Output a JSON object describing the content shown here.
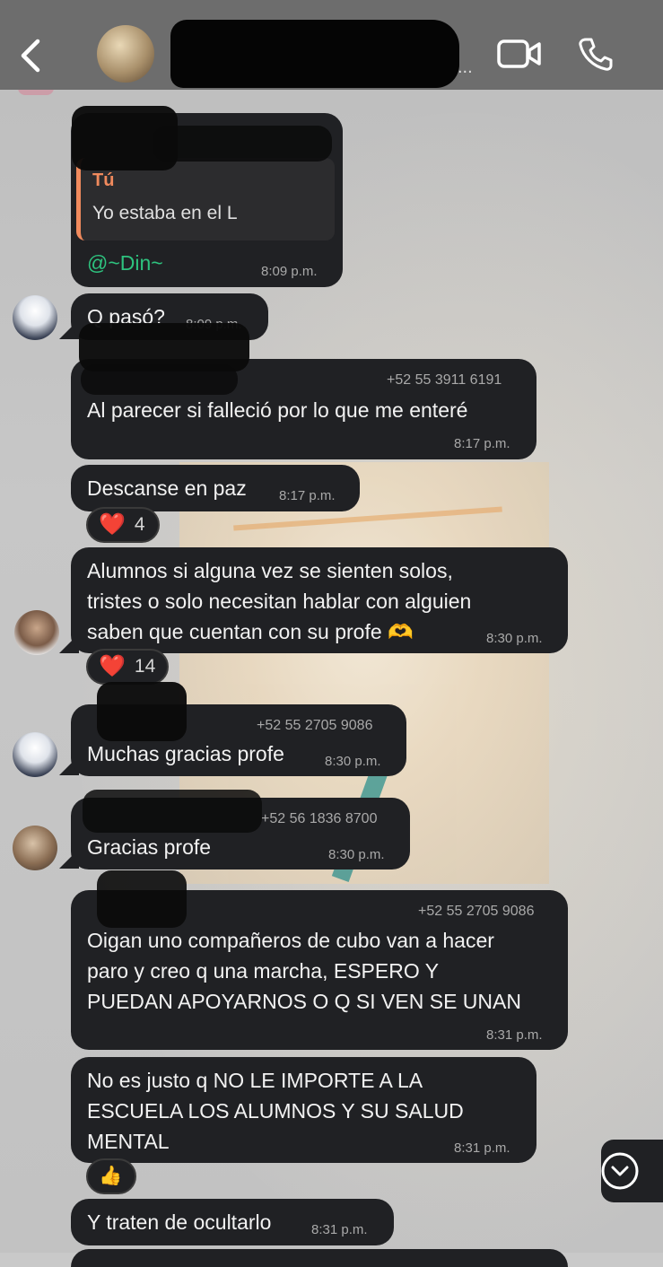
{
  "header": {
    "title_dots": "...",
    "video_icon": "video-camera-icon",
    "call_icon": "phone-icon",
    "back_icon": "chevron-left-icon"
  },
  "messages": [
    {
      "reply_author": "Tú",
      "reply_text": "Yo estaba en el L",
      "mention": "@~Din~",
      "time": "8:09 p.m."
    },
    {
      "text": "Q pasó?",
      "time": "8:09 p.m."
    },
    {
      "phone": "+52 55 3911 6191",
      "text": "Al parecer si falleció por lo que me enteré",
      "time": "8:17 p.m."
    },
    {
      "text": "Descanse en paz",
      "time": "8:17 p.m.",
      "reaction": "4"
    },
    {
      "text": "Alumnos si alguna vez se sienten solos,\ntristes o solo necesitan hablar con alguien\nsaben que cuentan con su profe 🫶",
      "time": "8:30 p.m.",
      "reaction": "14"
    },
    {
      "phone": "+52 55 2705 9086",
      "text": "Muchas gracias profe",
      "time": "8:30 p.m."
    },
    {
      "phone": "+52 56 1836 8700",
      "text": "Gracias profe",
      "time": "8:30 p.m."
    },
    {
      "phone": "+52 55 2705 9086",
      "text": "Oigan uno compañeros de cubo van a hacer\nparo y creo q una marcha, ESPERO Y\nPUEDAN APOYARNOS O Q SI VEN SE UNAN",
      "time": "8:31 p.m."
    },
    {
      "text": "No es justo q NO LE IMPORTE A LA\nESCUELA LOS ALUMNOS Y SU SALUD\nMENTAL",
      "time": "8:31 p.m.",
      "reaction": "👍"
    },
    {
      "text": "Y traten de ocultarlo",
      "time": "8:31 p.m."
    }
  ],
  "reaction_heart": "❤️",
  "scroll_icon": "chevron-down-circle-icon",
  "colors": {
    "bubble": "#202124",
    "header": "#6d6d6d",
    "reply_accent": "#f08a5d",
    "mention": "#2ec27e"
  }
}
